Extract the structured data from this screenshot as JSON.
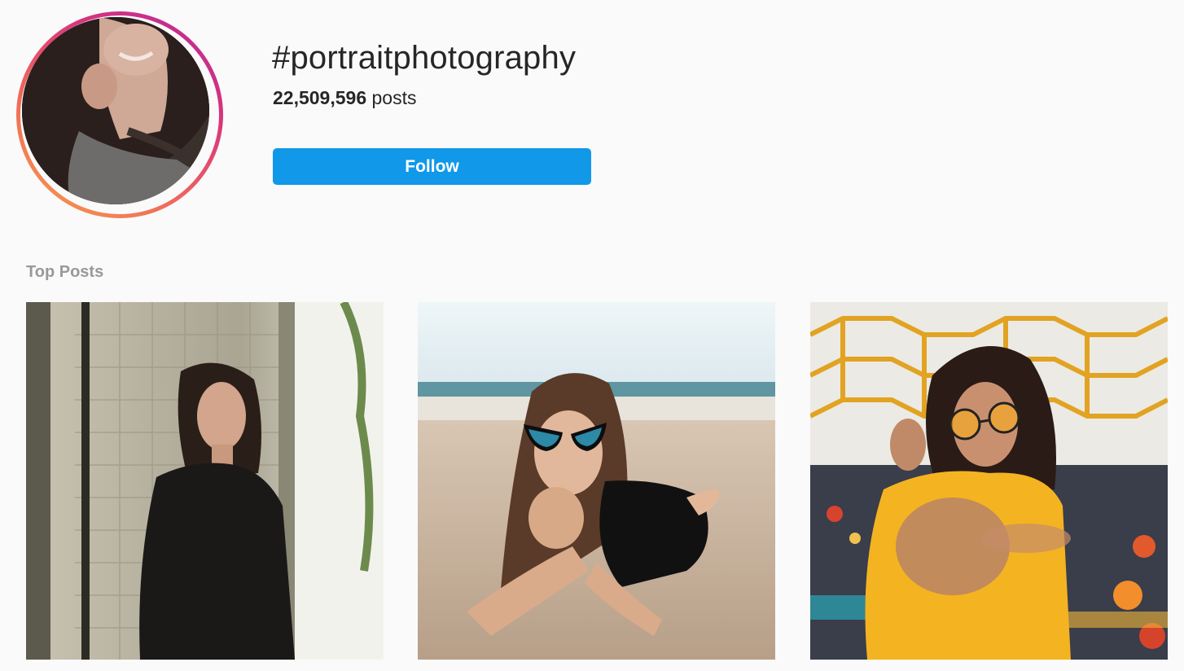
{
  "hashtag": {
    "title": "#portraitphotography",
    "posts_count": "22,509,596",
    "posts_label": "posts",
    "follow_label": "Follow",
    "avatar_image": "hashtag-avatar-photo"
  },
  "top_posts": {
    "heading": "Top Posts",
    "items": [
      {
        "image": "woman-in-black-top-leaning-against-tiled-wall"
      },
      {
        "image": "woman-with-cat-eye-sunglasses-lying-on-beach"
      },
      {
        "image": "woman-in-yellow-top-with-round-glasses-under-hexagon-canopy"
      }
    ]
  },
  "colors": {
    "follow_button": "#1198e9",
    "ring_gradient": [
      "#f7a04a",
      "#ef6a5b",
      "#d8337d",
      "#b52a9d"
    ],
    "muted_label": "#999999",
    "background": "#fafafa"
  }
}
